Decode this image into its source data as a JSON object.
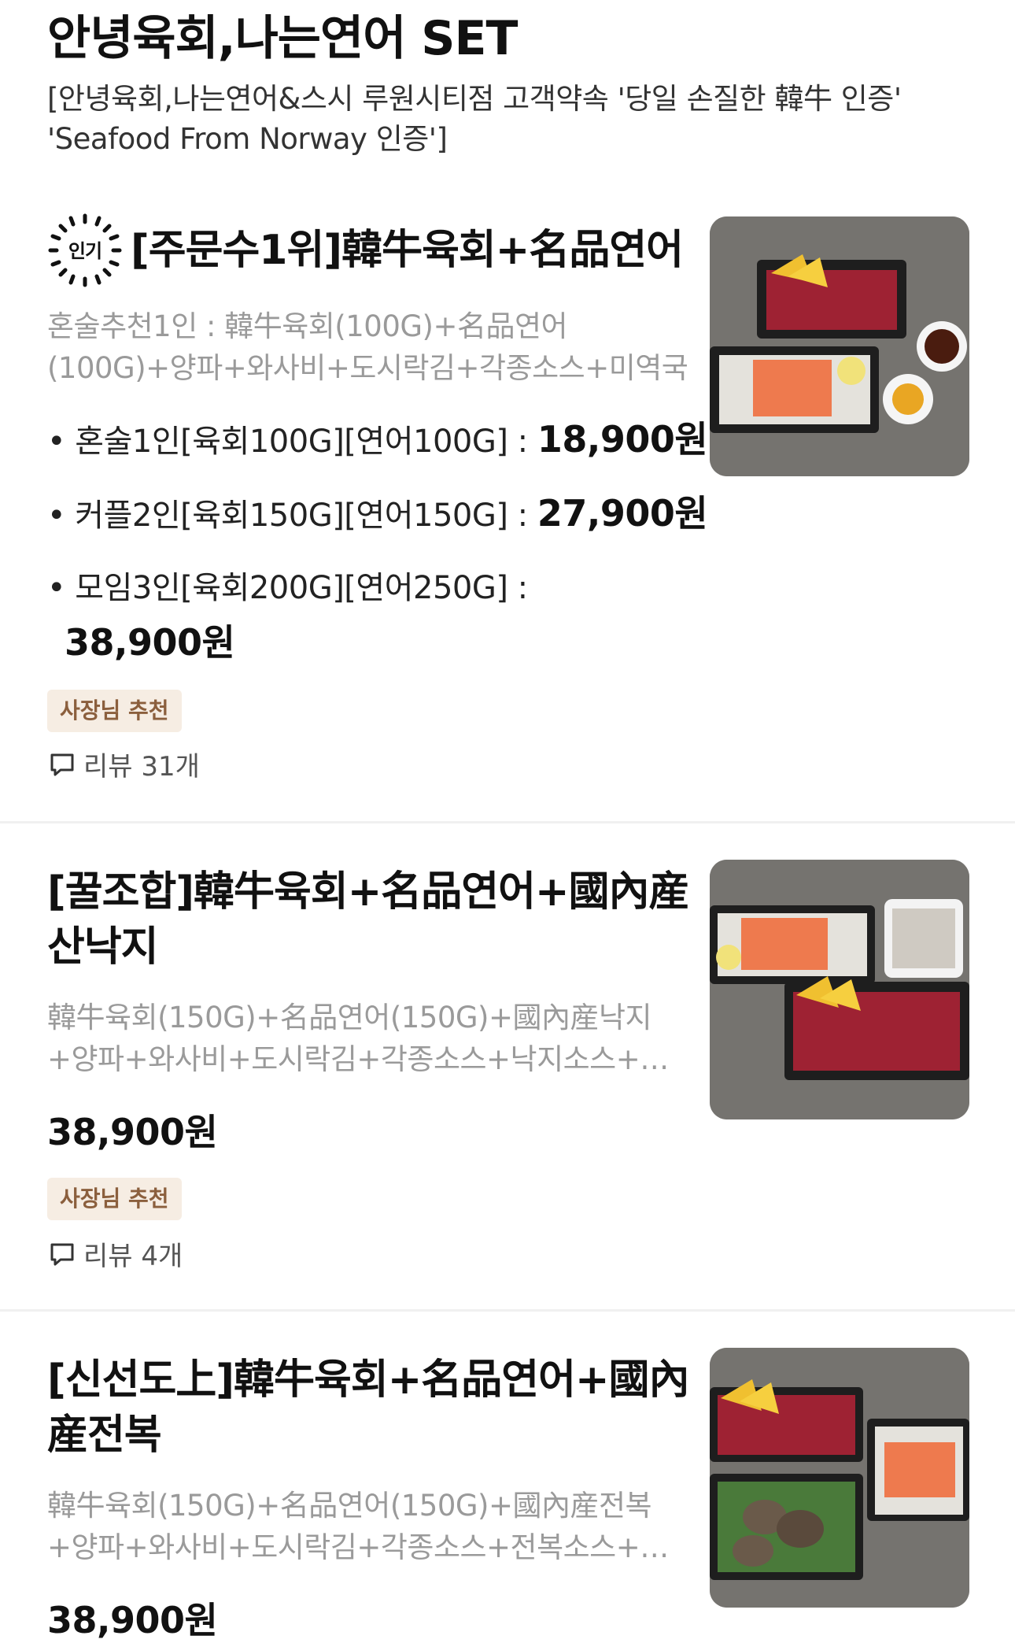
{
  "section": {
    "title": "안녕육회,나는연어 SET",
    "description": "[안녕육회,나는연어&스시 루원시티점 고객약속 '당일 손질한 韓牛 인증' 'Seafood From Norway 인증']"
  },
  "menu_items": [
    {
      "popular_badge": "인기",
      "title": "[주문수1위]韓牛육회+名品연어",
      "description": "혼술추천1인 : 韓牛육회(100G)+名品연어(100G)+양파+와사비+도시락김+각종소스+미역국+노…",
      "options": [
        {
          "label": "• 혼술1인[육회100G][연어100G] : ",
          "price": "18,900원"
        },
        {
          "label": "• 커플2인[육회150G][연어150G] : ",
          "price": "27,900원"
        },
        {
          "label": "• 모임3인[육회200G][연어250G] :",
          "price": "38,900원"
        }
      ],
      "badge": "사장님 추천",
      "review": "리뷰 31개"
    },
    {
      "title": "[꿀조합]韓牛육회+名品연어+國內産산낙지",
      "description": "韓牛육회(150G)+名品연어(150G)+國內産낙지+양파+와사비+도시락김+각종소스+낙지소스+…",
      "price": "38,900원",
      "badge": "사장님 추천",
      "review": "리뷰 4개"
    },
    {
      "title": "[신선도上]韓牛육회+名品연어+國內産전복",
      "description": "韓牛육회(150G)+名品연어(150G)+國內産전복+양파+와사비+도시락김+각종소스+전복소스+…",
      "price": "38,900원"
    }
  ],
  "icons": {
    "review": "speech-bubble-icon",
    "popular": "popular-dashed-circle-icon"
  },
  "colors": {
    "badge_bg": "#f6ede3",
    "badge_text": "#8b5f3d",
    "muted_text": "#9a9a9a"
  }
}
